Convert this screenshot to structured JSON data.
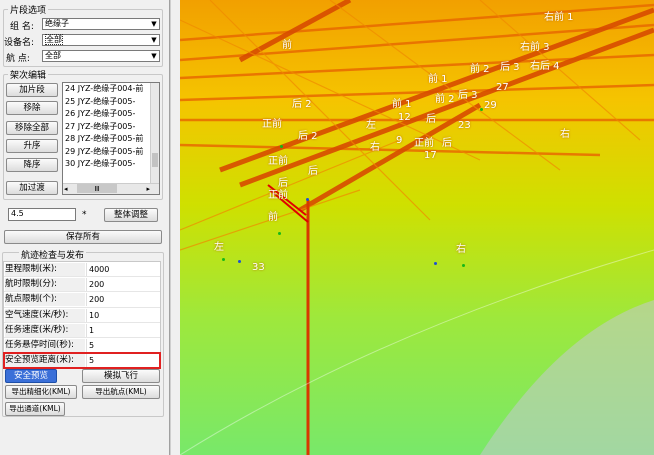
{
  "segment_options": {
    "title": "片段选项",
    "group_label": "组 名:",
    "group_value": "绝缘子",
    "device_label": "设备名:",
    "device_value": "全部",
    "waypoint_label": "航 点:",
    "waypoint_value": "全部"
  },
  "arch_edit": {
    "title": "架次编辑",
    "buttons": [
      "加片段",
      "移除",
      "移除全部",
      "升序",
      "降序",
      "加过渡"
    ],
    "list_items": [
      "24 JYZ-绝缘子004-前",
      "25 JYZ-绝缘子005-",
      "26 JYZ-绝缘子005-",
      "27 JYZ-绝缘子005-",
      "28 JYZ-绝缘子005-前",
      "29 JYZ-绝缘子005-前",
      "30 JYZ-绝缘子005-"
    ],
    "scroll_thumb": "Ⅲ"
  },
  "adjust": {
    "value": "4.5",
    "unit": "*",
    "button": "整体调整"
  },
  "save_button": "保存所有",
  "route_check": {
    "title": "航迹检查与发布",
    "rows": [
      {
        "key": "里程限制(米):",
        "value": "4000"
      },
      {
        "key": "航时限制(分):",
        "value": "200"
      },
      {
        "key": "航点限制(个):",
        "value": "200"
      },
      {
        "key": "空气速度(米/秒):",
        "value": "10"
      },
      {
        "key": "任务速度(米/秒):",
        "value": "1"
      },
      {
        "key": "任务悬停时间(秒):",
        "value": "5"
      },
      {
        "key": "安全预览距离(米):",
        "value": "5"
      }
    ],
    "buttons": {
      "safe_preview": "安全预览",
      "simulate": "模拟飞行",
      "export_refine": "导出精细化(KML)",
      "export_waypoint": "导出航点(KML)",
      "export_channel": "导出通道(KML)"
    }
  },
  "viewport_labels": [
    "右前 1",
    "右前 3",
    "右后 4",
    "前 2",
    "后 3",
    "前",
    "前 1",
    "前 2",
    "后 3",
    "27",
    "29",
    "后 2",
    "前 1",
    "左",
    "12",
    "后",
    "23",
    "正前",
    "后 2",
    "右",
    "9",
    "正前",
    "后",
    "17",
    "正前",
    "后",
    "后",
    "左",
    "右",
    "33",
    "正前",
    "右",
    "前"
  ],
  "colors": {
    "accent_border": "#e02020",
    "selected_button": "#3a6fd8"
  }
}
